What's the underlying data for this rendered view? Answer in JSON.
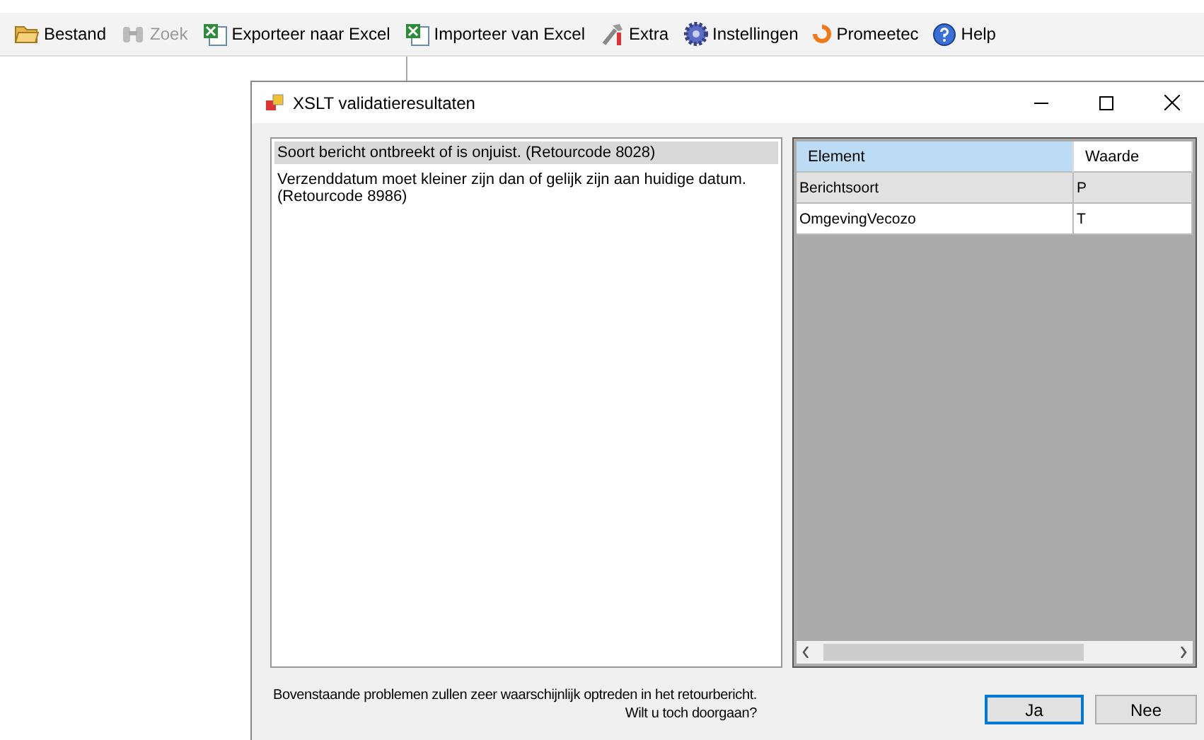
{
  "toolbar": [
    {
      "label": "Bestand",
      "disabled": false
    },
    {
      "label": "Zoek",
      "disabled": true
    },
    {
      "label": "Exporteer naar Excel",
      "disabled": false
    },
    {
      "label": "Importeer van Excel",
      "disabled": false
    },
    {
      "label": "Extra",
      "disabled": false
    },
    {
      "label": "Instellingen",
      "disabled": false
    },
    {
      "label": "Promeetec",
      "disabled": false
    },
    {
      "label": "Help",
      "disabled": false
    }
  ],
  "dialog": {
    "title": "XSLT validatieresultaten",
    "messages": [
      {
        "text": "Soort bericht ontbreekt of is onjuist. (Retourcode 8028)",
        "selected": true
      },
      {
        "text": "Verzenddatum moet kleiner zijn dan of gelijk zijn aan huidige datum. (Retourcode 8986)",
        "selected": false
      }
    ],
    "grid": {
      "columns": [
        {
          "label": "Element",
          "selected": true
        },
        {
          "label": "Waarde",
          "selected": false
        }
      ],
      "rows": [
        {
          "cells": [
            "Berichtsoort",
            "P"
          ],
          "selected": true
        },
        {
          "cells": [
            "OmgevingVecozo",
            "T"
          ],
          "selected": false
        }
      ]
    },
    "footer": [
      "Bovenstaande problemen zullen zeer waarschijnlijk optreden in het retourbericht.",
      "Wilt u toch doorgaan?"
    ],
    "buttons": [
      {
        "label": "Ja",
        "default": true
      },
      {
        "label": "Nee",
        "default": false
      }
    ]
  }
}
